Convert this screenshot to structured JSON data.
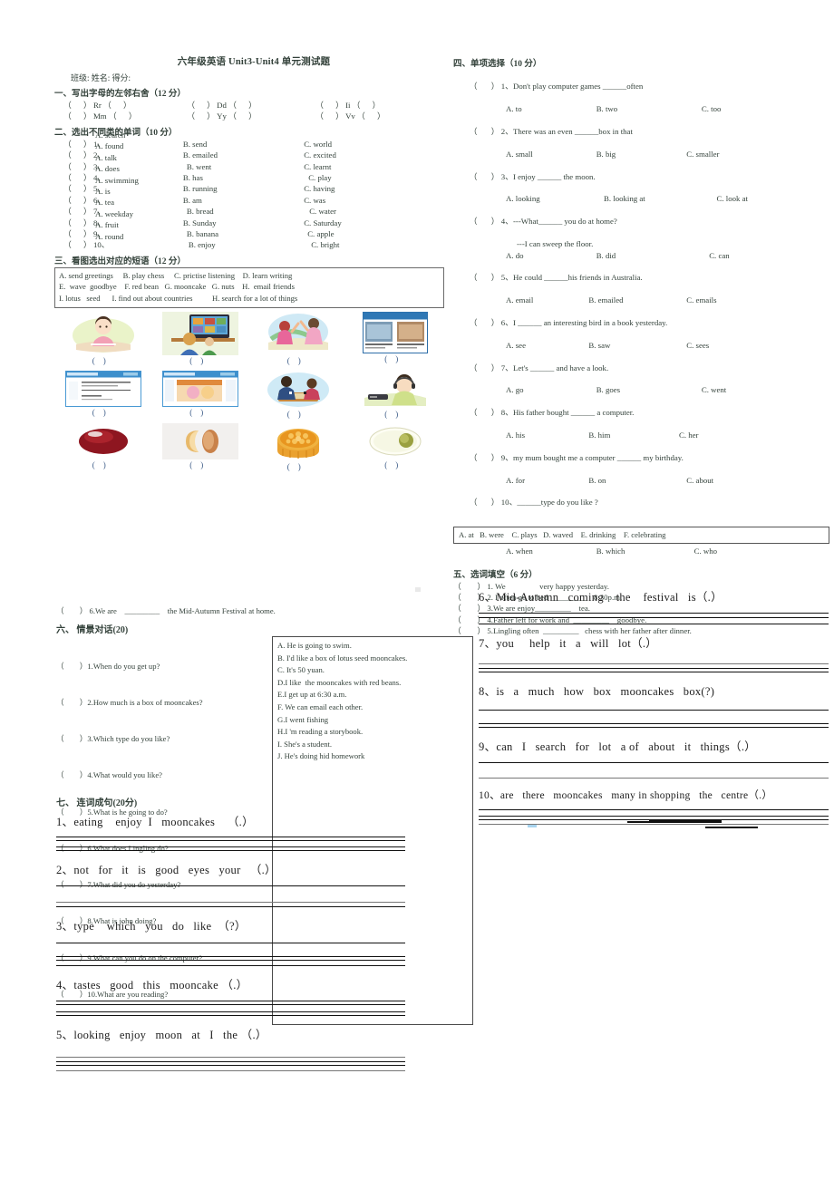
{
  "document": {
    "title": "六年级英语 Unit3-Unit4 单元测试题",
    "info_line": "班级:              姓名:              得分:"
  },
  "section1": {
    "heading": "一、写出字母的左邻右舍（12 分）",
    "rows": [
      [
        "（      ） Rr （      ）",
        "（      ） Dd （      ）",
        "（      ） Ii （      ）"
      ],
      [
        "（      ） Mm （      ）",
        "（      ） Yy （      ）",
        "（      ） Vv （      ）"
      ]
    ]
  },
  "section2": {
    "heading": "二、选出不同类的单词（10 分）",
    "items": [
      {
        "mark": "（      ） 1、",
        "a": "A. search",
        "b": "B. send",
        "c": "C. world"
      },
      {
        "mark": "（      ） 2、",
        "a": "A. found",
        "b": "B. emailed",
        "c": "C. excited"
      },
      {
        "mark": "（      ） 3、",
        "a": "A. talk",
        "b": "B. went",
        "c": "C. learnt"
      },
      {
        "mark": "（      ） 4、",
        "a": "A. does",
        "b": "B. has",
        "c": "C. play"
      },
      {
        "mark": "（      ） 5、",
        "a": "A. swimming",
        "b": "B. running",
        "c": "C. having"
      },
      {
        "mark": "（      ） 6、",
        "a": "A. is",
        "b": "B. am",
        "c": "C. was"
      },
      {
        "mark": "（      ） 7、",
        "a": "A. tea",
        "b": "B. bread",
        "c": "C. water"
      },
      {
        "mark": "（      ） 8、",
        "a": "A. weekday",
        "b": "B. Sunday",
        "c": "C. Saturday"
      },
      {
        "mark": "（      ） 9、",
        "a": "A. fruit",
        "b": "B. banana",
        "c": "C. apple"
      },
      {
        "mark": "（      ） 10、",
        "a": "A. round",
        "b": "B. enjoy",
        "c": "C. bright"
      }
    ]
  },
  "section3": {
    "heading": "三、看图选出对应的短语（12 分）",
    "bank": [
      "A. send greetings     B. play chess     C. prictise listening    D. learn writing",
      "E.  wave  goodbye    F. red bean   G. mooncake   G. nuts    H.  email friends",
      "I. lotus   seed      I. find out about countries          H. search for a lot of things"
    ],
    "picture_grid": {
      "rows": [
        [
          "girl-writing",
          "kids-computer-screen",
          "girls-waving-goodbye",
          "webpage-countries"
        ],
        [
          "webpage-email-form",
          "webpage-greeting-card",
          "family-playing-chess",
          "boy-headphones-listening"
        ],
        [
          "red-bean",
          "nuts-cashew-almond",
          "mooncake",
          "lotus-seed"
        ]
      ],
      "answer_blank": "（        ）"
    }
  },
  "section4": {
    "heading": "四、单项选择（10 分）",
    "items": [
      {
        "mark": "（       ） 1、",
        "stem": "Don't play computer games ______often",
        "a": "A. to",
        "b": "B. two",
        "c": "C. too"
      },
      {
        "mark": "（       ） 2、",
        "stem": "There was an even ______box in that",
        "a": "A. small",
        "b": "B. big",
        "c": "C. smaller"
      },
      {
        "mark": "（       ） 3、",
        "stem": "I enjoy ______ the moon.",
        "a": "A. looking",
        "b": "B. looking at",
        "c": "C. look at"
      },
      {
        "mark": "（       ） 4、",
        "stem": "---What______ you do at home?",
        "stem2": "---I can sweep the floor.",
        "a": "A. do",
        "b": "B. did",
        "c": "C. can"
      },
      {
        "mark": "（       ） 5、",
        "stem": "He could ______his friends in Australia.",
        "a": "A. email",
        "b": "B. emailed",
        "c": "C. emails"
      },
      {
        "mark": "（       ） 6、",
        "stem": "I ______ an interesting bird in a book yesterday.",
        "a": "A. see",
        "b": "B. saw",
        "c": "C. sees"
      },
      {
        "mark": "（       ） 7、",
        "stem": "Let's ______ and have a look.",
        "a": "A. go",
        "b": "B. goes",
        "c": "C. went"
      },
      {
        "mark": "（       ） 8、",
        "stem": "His father bought ______ a computer.",
        "a": "A. his",
        "b": "B. him",
        "c": "C. her"
      },
      {
        "mark": "（       ） 9、",
        "stem": "my mum bought me a computer ______ my birthday.",
        "a": "A. for",
        "b": "B. on",
        "c": "C. about"
      },
      {
        "mark": "（       ） 10、",
        "stem": "______type do you like ?",
        "a": "A. when",
        "b": "B. which",
        "c": "C. who"
      }
    ],
    "word_bank": "A. at   B. were    C. plays   D. waved    E. drinking    F. celebrating"
  },
  "section5": {
    "heading": "五、选词填空（6 分）",
    "items": [
      "（        ） 1. We                 very happy yesterday.",
      "（        ） 2. I often go to bed  _________   8:30p.m.",
      "（        ） 3.We are enjoy_________    tea.",
      "（        ） 4.Father left for work and  _________    goodbye.",
      "（        ） 5.Lingling often  _________   chess with her father after dinner.",
      "（        ） 6.We are    _________    the Mid-Autumn Festival at home."
    ]
  },
  "section6": {
    "heading": "六、        情景对话(20)",
    "questions": [
      "（        ）1.When do you get up?",
      "（        ）2.How much is a box of mooncakes?",
      "（        ）3.Which type do you like?",
      "（        ）4.What would you like?",
      "（        ）5.What is he going to do?",
      "（        ）6.What does Lingling do?",
      "（        ）7.What did you do yesterday?",
      "（        ）8.What is john doing?",
      "（        ）9.What can you do on the computer?",
      "（        ）10.What are you reading?"
    ],
    "answers": [
      "A. He is going to swim.",
      "B. I'd like a box of lotus seed mooncakes.",
      "C. It's 50 yuan.",
      "D.I like  the mooncakes with red beans.",
      "E.I get up at 6:30 a.m.",
      "F. We can email each other.",
      "G.I went fishing",
      "H.I 'm reading a storybook.",
      "I. She's a student.",
      "J. He's doing hid homework"
    ]
  },
  "section7": {
    "heading": "七、        连词成句(20分)",
    "items_left": [
      "1、eating    enjoy  I   mooncakes    （.）",
      "2、not   for   it   is   good   eyes   your   （.）",
      "3、type    which   you   do   like  （?）",
      "4、tastes   good   this   mooncake （.）",
      "5、looking   enjoy   moon   at   I   the （.）"
    ],
    "items_right": [
      "6、Mid-Autumn   coming    the    festival   is（.）",
      "7、you     help   it   a   will   lot（.）",
      "8、is   a   much   how   box   mooncakes   box(?)",
      "9、can   I   search   for   lot   a of   about   it   things（.）",
      "10、are   there   mooncakes   many in shopping   the   centre（.）"
    ]
  }
}
